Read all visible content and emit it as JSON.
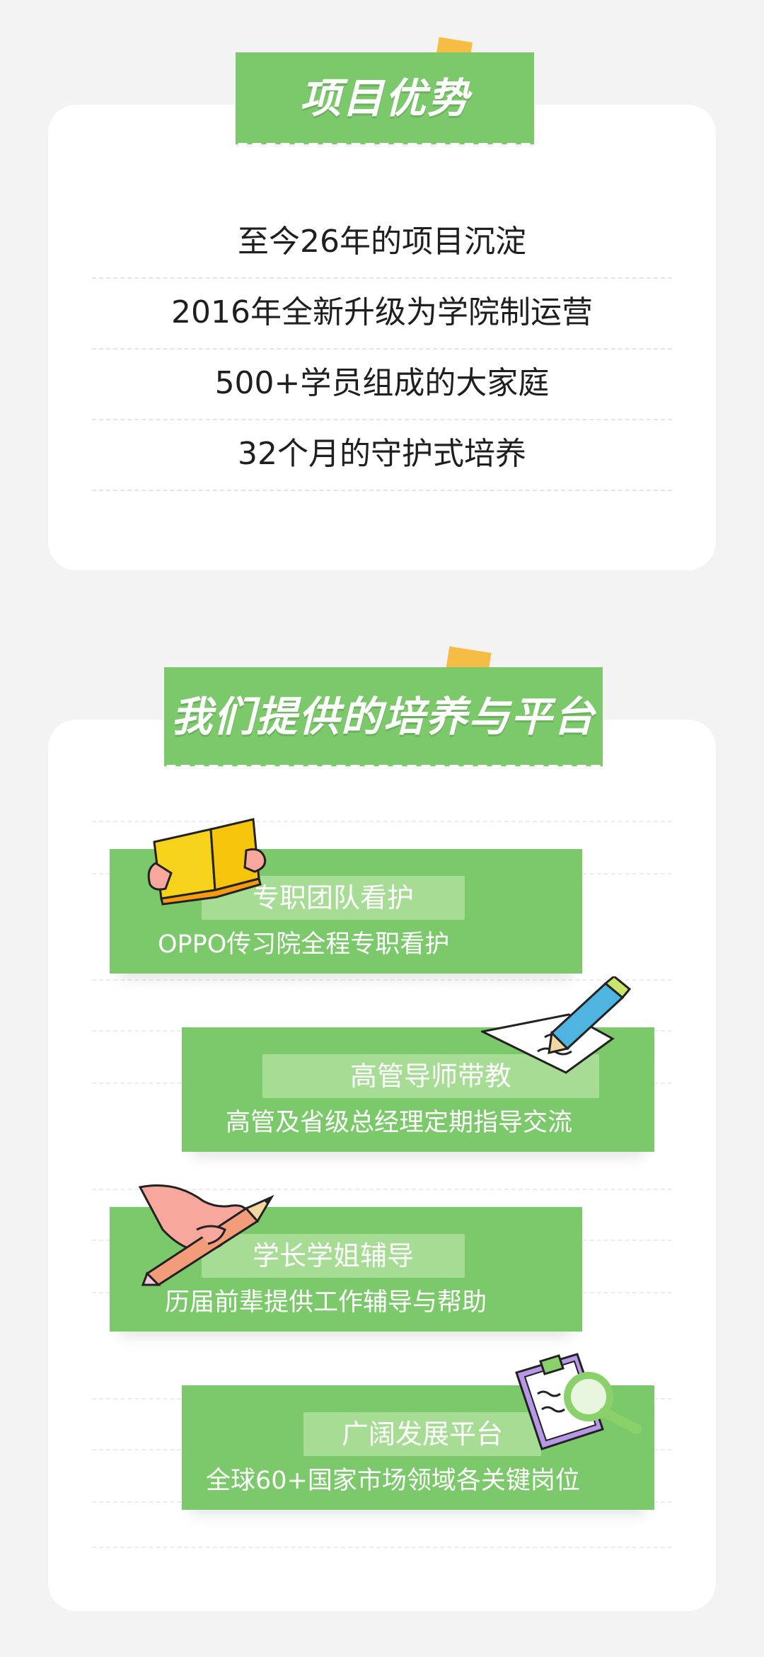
{
  "advantages": {
    "title": "项目优势",
    "items": [
      "至今26年的项目沉淀",
      "2016年全新升级为学院制运营",
      "500+学员组成的大家庭",
      "32个月的守护式培养"
    ]
  },
  "platform": {
    "title": "我们提供的培养与平台",
    "items": [
      {
        "title": "专职团队看护",
        "desc": "OPPO传习院全程专职看护",
        "icon": "book-icon"
      },
      {
        "title": "高管导师带教",
        "desc": "高管及省级总经理定期指导交流",
        "icon": "pen-paper-icon"
      },
      {
        "title": "学长学姐辅导",
        "desc": "历届前辈提供工作辅导与帮助",
        "icon": "hand-pencil-icon"
      },
      {
        "title": "广阔发展平台",
        "desc": "全球60+国家市场领域各关键岗位",
        "icon": "clipboard-magnifier-icon"
      }
    ]
  },
  "colors": {
    "accent_green": "#7cc96b",
    "light_green": "#a6dc94",
    "tape_yellow": "#f6b93b",
    "background": "#f3f3f3"
  }
}
